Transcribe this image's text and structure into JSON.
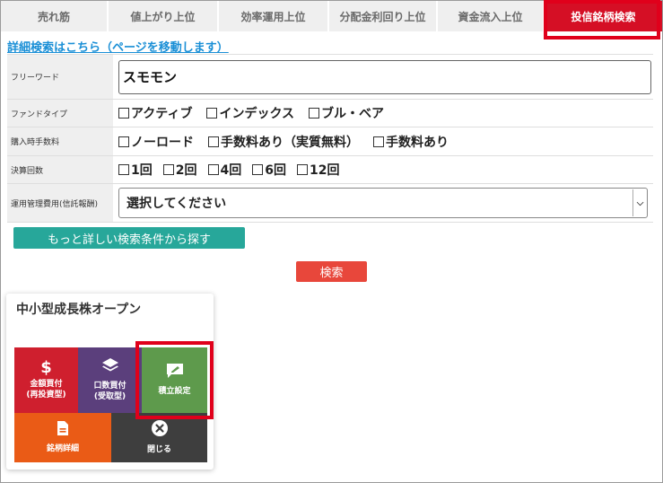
{
  "tabs": [
    {
      "label": "売れ筋"
    },
    {
      "label": "値上がり上位"
    },
    {
      "label": "効率運用上位"
    },
    {
      "label": "分配金利回り上位"
    },
    {
      "label": "資金流入上位"
    },
    {
      "label": "投信銘柄検索"
    }
  ],
  "active_tab": "投信銘柄検索",
  "detail_link": "詳細検索はこちら（ページを移動します）",
  "form": {
    "freeword": {
      "label": "フリーワード",
      "value": "スモモン"
    },
    "fund_type": {
      "label": "ファンドタイプ",
      "options": [
        "アクティブ",
        "インデックス",
        "ブル・ベア"
      ]
    },
    "fee": {
      "label": "購入時手数料",
      "options": [
        "ノーロード",
        "手数料あり（実質無料）",
        "手数料あり"
      ]
    },
    "settlement": {
      "label": "決算回数",
      "options": [
        "1回",
        "2回",
        "4回",
        "6回",
        "12回"
      ]
    },
    "management_cost": {
      "label": "運用管理費用(信託報酬)",
      "selected": "選択してください"
    }
  },
  "buttons": {
    "more": "もっと詳しい検索条件から探す",
    "search": "検索"
  },
  "card": {
    "title": "中小型成長株オープン",
    "actions": {
      "buy_amount": {
        "line1": "金額買付",
        "line2": "(再投資型)"
      },
      "buy_units": {
        "line1": "口数買付",
        "line2": "(受取型)"
      },
      "reserve": {
        "line1": "積立設定"
      },
      "detail": {
        "line1": "銘柄詳細"
      },
      "close": {
        "line1": "閉じる"
      }
    }
  },
  "colors": {
    "active_tab": "#d50f25",
    "link": "#1a8fd6",
    "more_button": "#27a79a",
    "search_button": "#e8473b",
    "highlight": "#e0001b",
    "buy_amount": "#cf1f2e",
    "buy_units": "#5b3f7c",
    "reserve": "#5e9a4c",
    "detail": "#ea5b16",
    "close": "#3e3e3e"
  },
  "icons": {
    "buy_amount": "dollar-icon",
    "buy_units": "layers-icon",
    "reserve": "edit-chat-icon",
    "detail": "document-icon",
    "close": "close-circle-icon"
  }
}
